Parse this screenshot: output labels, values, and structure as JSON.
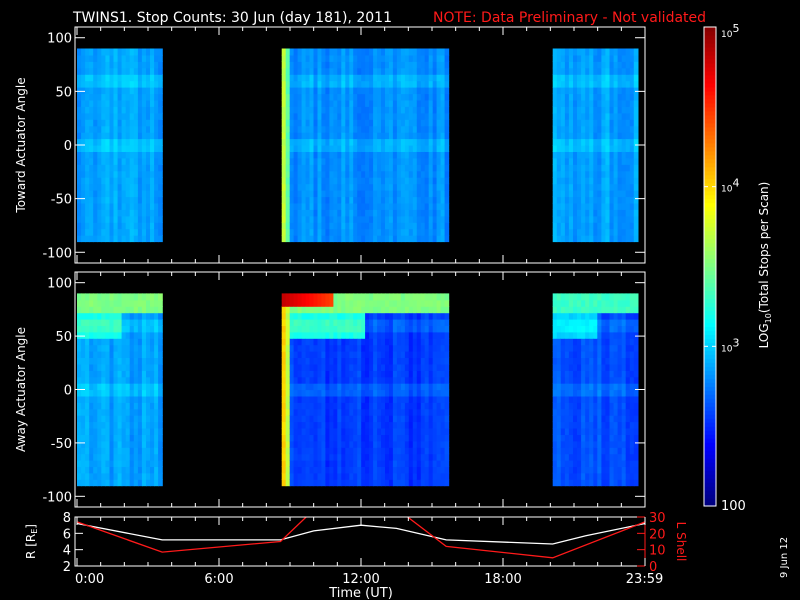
{
  "chart_data": {
    "type": "heatmap",
    "title": "TWINS1. Stop Counts: 30 Jun (day 181), 2011",
    "note": "NOTE: Data Preliminary - Not validated",
    "xlabel": "Time (UT)",
    "xlim_hours": [
      0,
      24
    ],
    "x_ticks": [
      {
        "h": 0,
        "label": "0:00"
      },
      {
        "h": 6,
        "label": "6:00"
      },
      {
        "h": 12,
        "label": "12:00"
      },
      {
        "h": 18,
        "label": "18:00"
      },
      {
        "h": 23.98,
        "label": "23:59"
      }
    ],
    "panels": [
      {
        "ylabel": "Toward Actuator Angle",
        "ylim": [
          -110,
          110
        ],
        "y_ticks": [
          "100",
          "50",
          "0",
          "-50",
          "-100"
        ],
        "y_tick_values": [
          100,
          50,
          0,
          -50,
          -100
        ],
        "data_yrange": [
          -90,
          90
        ],
        "intervals": [
          {
            "start_h": 0,
            "end_h": 3.6,
            "base_log": 2.85
          },
          {
            "start_h": 8.65,
            "end_h": 15.7,
            "base_log": 2.8,
            "edge_log": 3.7
          },
          {
            "start_h": 20.1,
            "end_h": 23.7,
            "base_log": 2.85
          }
        ]
      },
      {
        "ylabel": "Away Actuator Angle",
        "ylim": [
          -110,
          110
        ],
        "y_ticks": [
          "100",
          "50",
          "0",
          "-50",
          "-100"
        ],
        "y_tick_values": [
          100,
          50,
          0,
          -50,
          -100
        ],
        "data_yrange": [
          -90,
          90
        ],
        "intervals": [
          {
            "start_h": 0,
            "end_h": 3.6,
            "base_log": 2.85,
            "top_log": 3.5
          },
          {
            "start_h": 8.65,
            "end_h": 15.7,
            "base_log": 2.55,
            "edge_log": 4.0,
            "top_log": 3.5,
            "peak_log": 4.8
          },
          {
            "start_h": 20.1,
            "end_h": 23.7,
            "base_log": 2.6,
            "top_log": 3.3
          }
        ]
      }
    ],
    "colorbar": {
      "label": "LOG10(Total Stops per Scan)",
      "label_main": "LOG",
      "label_sub": "10",
      "label_rest": "(Total Stops per Scan)",
      "range_log": [
        2,
        5
      ],
      "ticks": [
        {
          "log": 5,
          "base": "10",
          "exp": "5"
        },
        {
          "log": 4,
          "base": "10",
          "exp": "4"
        },
        {
          "log": 3,
          "base": "10",
          "exp": "3"
        },
        {
          "log": 2,
          "base": "100",
          "exp": ""
        }
      ]
    },
    "orbit": {
      "left_label": "R [R",
      "left_label_sub": "E",
      "left_label_end": "]",
      "left_ylim": [
        2,
        8
      ],
      "left_ticks": [
        "8",
        "6",
        "4",
        "2"
      ],
      "left_tick_values": [
        8,
        6,
        4,
        2
      ],
      "right_label": "L Shell",
      "right_ylim": [
        0,
        30
      ],
      "right_ticks": [
        "30",
        "20",
        "10",
        "0"
      ],
      "right_tick_values": [
        30,
        20,
        10,
        0
      ],
      "R": [
        [
          0,
          7.2
        ],
        [
          3.6,
          5.2
        ],
        [
          8.6,
          5.2
        ],
        [
          10,
          6.3
        ],
        [
          12,
          7.0
        ],
        [
          13.5,
          6.6
        ],
        [
          15.6,
          5.2
        ],
        [
          20.1,
          4.7
        ],
        [
          21.5,
          5.7
        ],
        [
          24,
          7.2
        ]
      ],
      "L": [
        [
          0,
          27
        ],
        [
          3.6,
          8.5
        ],
        [
          8.6,
          15
        ],
        [
          9.9,
          33
        ],
        [
          13.7,
          33
        ],
        [
          15.6,
          12
        ],
        [
          20.1,
          5
        ],
        [
          24,
          27
        ]
      ]
    },
    "colors": {
      "R": "#ffffff",
      "L": "#ff1a1a",
      "note": "#ff1a1a"
    }
  },
  "footer": {
    "date_stamp": "9 Jun 12"
  }
}
